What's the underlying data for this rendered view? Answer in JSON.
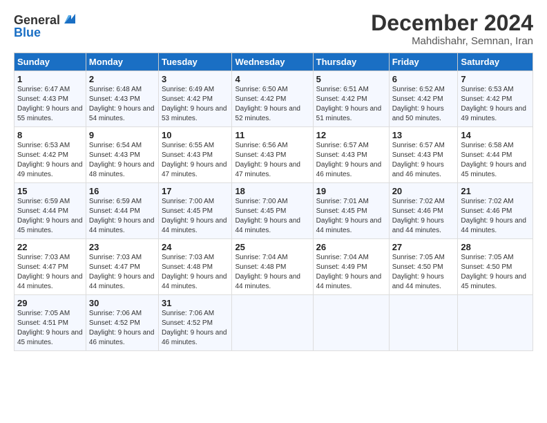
{
  "logo": {
    "general": "General",
    "blue": "Blue"
  },
  "title": "December 2024",
  "subtitle": "Mahdishahr, Semnan, Iran",
  "days_header": [
    "Sunday",
    "Monday",
    "Tuesday",
    "Wednesday",
    "Thursday",
    "Friday",
    "Saturday"
  ],
  "weeks": [
    [
      {
        "num": "1",
        "sunrise": "6:47 AM",
        "sunset": "4:43 PM",
        "daylight": "9 hours and 55 minutes."
      },
      {
        "num": "2",
        "sunrise": "6:48 AM",
        "sunset": "4:43 PM",
        "daylight": "9 hours and 54 minutes."
      },
      {
        "num": "3",
        "sunrise": "6:49 AM",
        "sunset": "4:42 PM",
        "daylight": "9 hours and 53 minutes."
      },
      {
        "num": "4",
        "sunrise": "6:50 AM",
        "sunset": "4:42 PM",
        "daylight": "9 hours and 52 minutes."
      },
      {
        "num": "5",
        "sunrise": "6:51 AM",
        "sunset": "4:42 PM",
        "daylight": "9 hours and 51 minutes."
      },
      {
        "num": "6",
        "sunrise": "6:52 AM",
        "sunset": "4:42 PM",
        "daylight": "9 hours and 50 minutes."
      },
      {
        "num": "7",
        "sunrise": "6:53 AM",
        "sunset": "4:42 PM",
        "daylight": "9 hours and 49 minutes."
      }
    ],
    [
      {
        "num": "8",
        "sunrise": "6:53 AM",
        "sunset": "4:42 PM",
        "daylight": "9 hours and 49 minutes."
      },
      {
        "num": "9",
        "sunrise": "6:54 AM",
        "sunset": "4:43 PM",
        "daylight": "9 hours and 48 minutes."
      },
      {
        "num": "10",
        "sunrise": "6:55 AM",
        "sunset": "4:43 PM",
        "daylight": "9 hours and 47 minutes."
      },
      {
        "num": "11",
        "sunrise": "6:56 AM",
        "sunset": "4:43 PM",
        "daylight": "9 hours and 47 minutes."
      },
      {
        "num": "12",
        "sunrise": "6:57 AM",
        "sunset": "4:43 PM",
        "daylight": "9 hours and 46 minutes."
      },
      {
        "num": "13",
        "sunrise": "6:57 AM",
        "sunset": "4:43 PM",
        "daylight": "9 hours and 46 minutes."
      },
      {
        "num": "14",
        "sunrise": "6:58 AM",
        "sunset": "4:44 PM",
        "daylight": "9 hours and 45 minutes."
      }
    ],
    [
      {
        "num": "15",
        "sunrise": "6:59 AM",
        "sunset": "4:44 PM",
        "daylight": "9 hours and 45 minutes."
      },
      {
        "num": "16",
        "sunrise": "6:59 AM",
        "sunset": "4:44 PM",
        "daylight": "9 hours and 44 minutes."
      },
      {
        "num": "17",
        "sunrise": "7:00 AM",
        "sunset": "4:45 PM",
        "daylight": "9 hours and 44 minutes."
      },
      {
        "num": "18",
        "sunrise": "7:00 AM",
        "sunset": "4:45 PM",
        "daylight": "9 hours and 44 minutes."
      },
      {
        "num": "19",
        "sunrise": "7:01 AM",
        "sunset": "4:45 PM",
        "daylight": "9 hours and 44 minutes."
      },
      {
        "num": "20",
        "sunrise": "7:02 AM",
        "sunset": "4:46 PM",
        "daylight": "9 hours and 44 minutes."
      },
      {
        "num": "21",
        "sunrise": "7:02 AM",
        "sunset": "4:46 PM",
        "daylight": "9 hours and 44 minutes."
      }
    ],
    [
      {
        "num": "22",
        "sunrise": "7:03 AM",
        "sunset": "4:47 PM",
        "daylight": "9 hours and 44 minutes."
      },
      {
        "num": "23",
        "sunrise": "7:03 AM",
        "sunset": "4:47 PM",
        "daylight": "9 hours and 44 minutes."
      },
      {
        "num": "24",
        "sunrise": "7:03 AM",
        "sunset": "4:48 PM",
        "daylight": "9 hours and 44 minutes."
      },
      {
        "num": "25",
        "sunrise": "7:04 AM",
        "sunset": "4:48 PM",
        "daylight": "9 hours and 44 minutes."
      },
      {
        "num": "26",
        "sunrise": "7:04 AM",
        "sunset": "4:49 PM",
        "daylight": "9 hours and 44 minutes."
      },
      {
        "num": "27",
        "sunrise": "7:05 AM",
        "sunset": "4:50 PM",
        "daylight": "9 hours and 44 minutes."
      },
      {
        "num": "28",
        "sunrise": "7:05 AM",
        "sunset": "4:50 PM",
        "daylight": "9 hours and 45 minutes."
      }
    ],
    [
      {
        "num": "29",
        "sunrise": "7:05 AM",
        "sunset": "4:51 PM",
        "daylight": "9 hours and 45 minutes."
      },
      {
        "num": "30",
        "sunrise": "7:06 AM",
        "sunset": "4:52 PM",
        "daylight": "9 hours and 46 minutes."
      },
      {
        "num": "31",
        "sunrise": "7:06 AM",
        "sunset": "4:52 PM",
        "daylight": "9 hours and 46 minutes."
      },
      null,
      null,
      null,
      null
    ]
  ]
}
